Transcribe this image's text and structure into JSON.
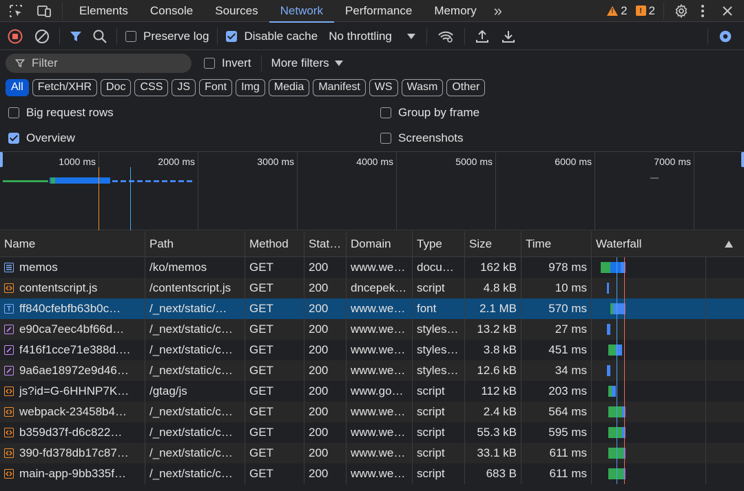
{
  "tabs": [
    "Elements",
    "Console",
    "Sources",
    "Network",
    "Performance",
    "Memory"
  ],
  "active_tab": "Network",
  "more_tabs": "»",
  "warnings_count": "2",
  "issues_count": "2",
  "toolbar": {
    "preserve_log": "Preserve log",
    "disable_cache": "Disable cache",
    "throttling": "No throttling"
  },
  "filter": {
    "placeholder": "Filter",
    "invert": "Invert",
    "more_filters": "More filters"
  },
  "type_filters": [
    "All",
    "Fetch/XHR",
    "Doc",
    "CSS",
    "JS",
    "Font",
    "Img",
    "Media",
    "Manifest",
    "WS",
    "Wasm",
    "Other"
  ],
  "options": {
    "big_rows": "Big request rows",
    "group_by_frame": "Group by frame",
    "overview": "Overview",
    "screenshots": "Screenshots"
  },
  "overview_ticks": [
    "1000 ms",
    "2000 ms",
    "3000 ms",
    "4000 ms",
    "5000 ms",
    "6000 ms",
    "7000 ms"
  ],
  "columns": [
    "Name",
    "Path",
    "Method",
    "Stat…",
    "Domain",
    "Type",
    "Size",
    "Time",
    "Waterfall"
  ],
  "rows": [
    {
      "icon": "doc",
      "name": "memos",
      "path": "/ko/memos",
      "method": "GET",
      "status": "200",
      "domain": "www.we…",
      "type": "docu…",
      "size": "162 kB",
      "time": "978 ms",
      "wf": [
        [
          0.06,
          0.12,
          "#34a853"
        ],
        [
          0.12,
          0.19,
          "#1a73e8"
        ],
        [
          0.19,
          0.22,
          "#4285f4"
        ]
      ]
    },
    {
      "icon": "script",
      "name": "contentscript.js",
      "path": "/contentscript.js",
      "method": "GET",
      "status": "200",
      "domain": "dncepek…",
      "type": "script",
      "size": "4.8 kB",
      "time": "10 ms",
      "wf": [
        [
          0.1,
          0.115,
          "#4285f4"
        ]
      ]
    },
    {
      "icon": "font",
      "name": "ff840cfebfb63b0c…",
      "path": "/_next/static/…",
      "method": "GET",
      "status": "200",
      "domain": "www.we…",
      "type": "font",
      "size": "2.1 MB",
      "time": "570 ms",
      "wf": [
        [
          0.12,
          0.14,
          "#34a853"
        ],
        [
          0.14,
          0.22,
          "#4285f4"
        ]
      ]
    },
    {
      "icon": "style",
      "name": "e90ca7eec4bf66d…",
      "path": "/_next/static/c…",
      "method": "GET",
      "status": "200",
      "domain": "www.we…",
      "type": "styles…",
      "size": "13.2 kB",
      "time": "27 ms",
      "wf": [
        [
          0.1,
          0.12,
          "#4285f4"
        ]
      ]
    },
    {
      "icon": "style",
      "name": "f416f1cce71e388d.…",
      "path": "/_next/static/c…",
      "method": "GET",
      "status": "200",
      "domain": "www.we…",
      "type": "styles…",
      "size": "3.8 kB",
      "time": "451 ms",
      "wf": [
        [
          0.11,
          0.16,
          "#34a853"
        ],
        [
          0.16,
          0.2,
          "#4285f4"
        ]
      ]
    },
    {
      "icon": "style",
      "name": "9a6ae18972e9d46…",
      "path": "/_next/static/c…",
      "method": "GET",
      "status": "200",
      "domain": "www.we…",
      "type": "styles…",
      "size": "12.6 kB",
      "time": "34 ms",
      "wf": [
        [
          0.1,
          0.12,
          "#4285f4"
        ]
      ]
    },
    {
      "icon": "script",
      "name": "js?id=G-6HHNP7K…",
      "path": "/gtag/js",
      "method": "GET",
      "status": "200",
      "domain": "www.go…",
      "type": "script",
      "size": "112 kB",
      "time": "203 ms",
      "wf": [
        [
          0.11,
          0.13,
          "#34a853"
        ],
        [
          0.13,
          0.16,
          "#4285f4"
        ]
      ]
    },
    {
      "icon": "script",
      "name": "webpack-23458b4…",
      "path": "/_next/static/c…",
      "method": "GET",
      "status": "200",
      "domain": "www.we…",
      "type": "script",
      "size": "2.4 kB",
      "time": "564 ms",
      "wf": [
        [
          0.11,
          0.2,
          "#34a853"
        ],
        [
          0.2,
          0.22,
          "#4285f4"
        ]
      ]
    },
    {
      "icon": "script",
      "name": "b359d37f-d6c822…",
      "path": "/_next/static/c…",
      "method": "GET",
      "status": "200",
      "domain": "www.we…",
      "type": "script",
      "size": "55.3 kB",
      "time": "595 ms",
      "wf": [
        [
          0.11,
          0.2,
          "#34a853"
        ],
        [
          0.2,
          0.22,
          "#4285f4"
        ]
      ]
    },
    {
      "icon": "script",
      "name": "390-fd378db17c87…",
      "path": "/_next/static/c…",
      "method": "GET",
      "status": "200",
      "domain": "www.we…",
      "type": "script",
      "size": "33.1 kB",
      "time": "611 ms",
      "wf": [
        [
          0.11,
          0.21,
          "#34a853"
        ],
        [
          0.21,
          0.22,
          "#4285f4"
        ]
      ]
    },
    {
      "icon": "script",
      "name": "main-app-9bb335f…",
      "path": "/_next/static/c…",
      "method": "GET",
      "status": "200",
      "domain": "www.we…",
      "type": "script",
      "size": "683 B",
      "time": "611 ms",
      "wf": [
        [
          0.11,
          0.21,
          "#34a853"
        ],
        [
          0.21,
          0.22,
          "#4285f4"
        ]
      ]
    }
  ]
}
